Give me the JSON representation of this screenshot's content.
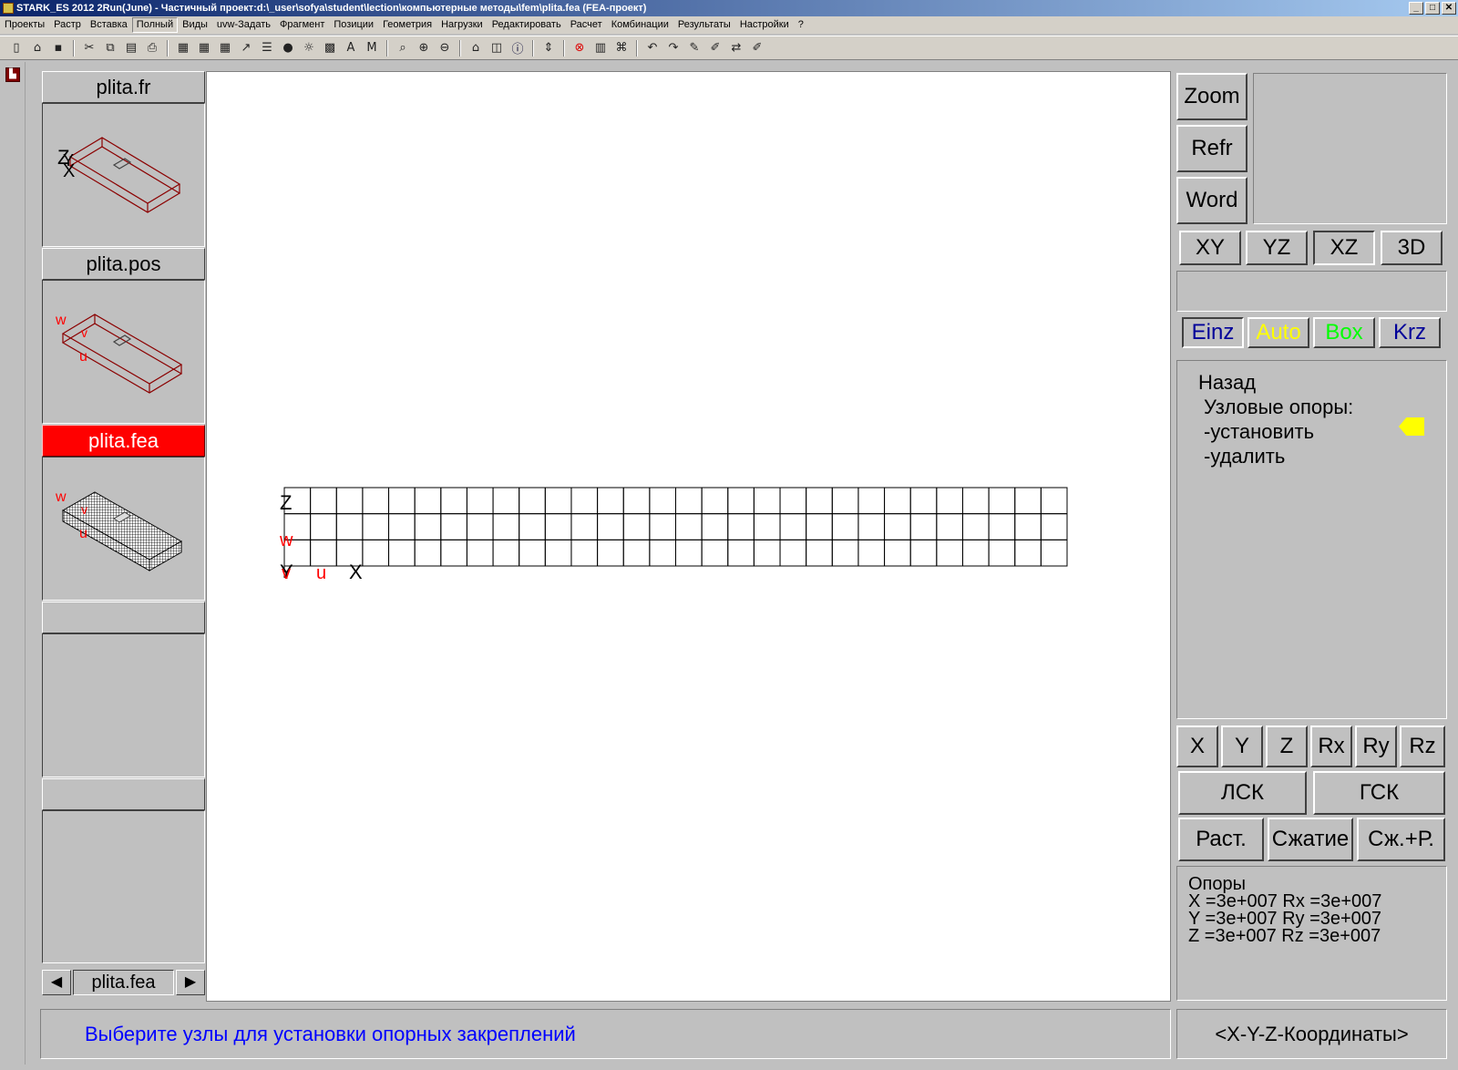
{
  "window": {
    "title": "STARK_ES 2012 2Run(June) - Частичный проект:d:\\_user\\sofya\\student\\lection\\компьютерные методы\\fem\\plita.fea  (FEA-проект)",
    "buttons": [
      "_",
      "□",
      "✕"
    ]
  },
  "menu": [
    "Проекты",
    "Растр",
    "Вставка",
    "Полный",
    "Виды",
    "uvw-Задать",
    "Фрагмент",
    "Позиции",
    "Геометрия",
    "Нагрузки",
    "Редактировать",
    "Расчет",
    "Комбинации",
    "Результаты",
    "Настройки",
    "?"
  ],
  "menu_active": "Полный",
  "toolbar_icons": [
    "new-icon",
    "open-icon",
    "save-icon",
    "cut-icon",
    "copy-icon",
    "paste-icon",
    "print-icon",
    "grid-icon",
    "grid2-icon",
    "grid3-icon",
    "axis-icon",
    "layer-icon",
    "color-icon",
    "light-icon",
    "hatch-icon",
    "text-icon",
    "mark-icon",
    "zoom-icon",
    "zoom-in-icon",
    "zoom-out-icon",
    "home-icon",
    "preview-icon",
    "info-icon",
    "select-icon",
    "stop-icon",
    "table-icon",
    "mesh-icon",
    "undo-icon",
    "redo-icon",
    "pen-icon",
    "draw-icon",
    "measure-icon",
    "brush-icon"
  ],
  "thumbs": {
    "items": [
      {
        "label": "plita.fr"
      },
      {
        "label": "plita.pos"
      },
      {
        "label": "plita.fea"
      },
      {
        "label": ""
      },
      {
        "label": ""
      }
    ],
    "nav_label": "plita.fea",
    "prev": "◀",
    "next": "▶"
  },
  "thumb_axes": {
    "fr": [
      "Z",
      "Y",
      "X"
    ],
    "pos": [
      "w",
      "v",
      "u"
    ],
    "fea": [
      "w",
      "v",
      "u"
    ]
  },
  "canvas": {
    "axis_z": "Z",
    "axis_w": "w",
    "axis_v": "v",
    "axis_u": "u",
    "axis_x": "X",
    "mesh": {
      "columns": 30,
      "rows": 3
    }
  },
  "right": {
    "zoom": "Zoom",
    "refr": "Refr",
    "word": "Word",
    "views": [
      "XY",
      "YZ",
      "XZ",
      "3D"
    ],
    "view_active": "XZ",
    "modes": [
      {
        "label": "Einz",
        "color": "#000099"
      },
      {
        "label": "Auto",
        "color": "#ffff00"
      },
      {
        "label": "Box",
        "color": "#00ff00"
      },
      {
        "label": "Krz",
        "color": "#000099"
      }
    ],
    "menu": {
      "back": "Назад",
      "heading": "Узловые опоры:",
      "set": "-установить",
      "delete": "-удалить"
    },
    "dofs": [
      "X",
      "Y",
      "Z",
      "Rx",
      "Ry",
      "Rz"
    ],
    "lsk": "ЛСК",
    "gsk": "ГСК",
    "rast": "Раст.",
    "szhatie": "Сжатие",
    "szhr": "Сж.+Р.",
    "info": {
      "title": "Опоры",
      "line1": "X =3e+007 Rx =3e+007",
      "line2": "Y =3e+007 Ry =3e+007",
      "line3": "Z =3e+007 Rz =3e+007"
    }
  },
  "status": {
    "message": "Выберите узлы для установки опорных закреплений",
    "coords": "<X-Y-Z-Координаты>"
  }
}
